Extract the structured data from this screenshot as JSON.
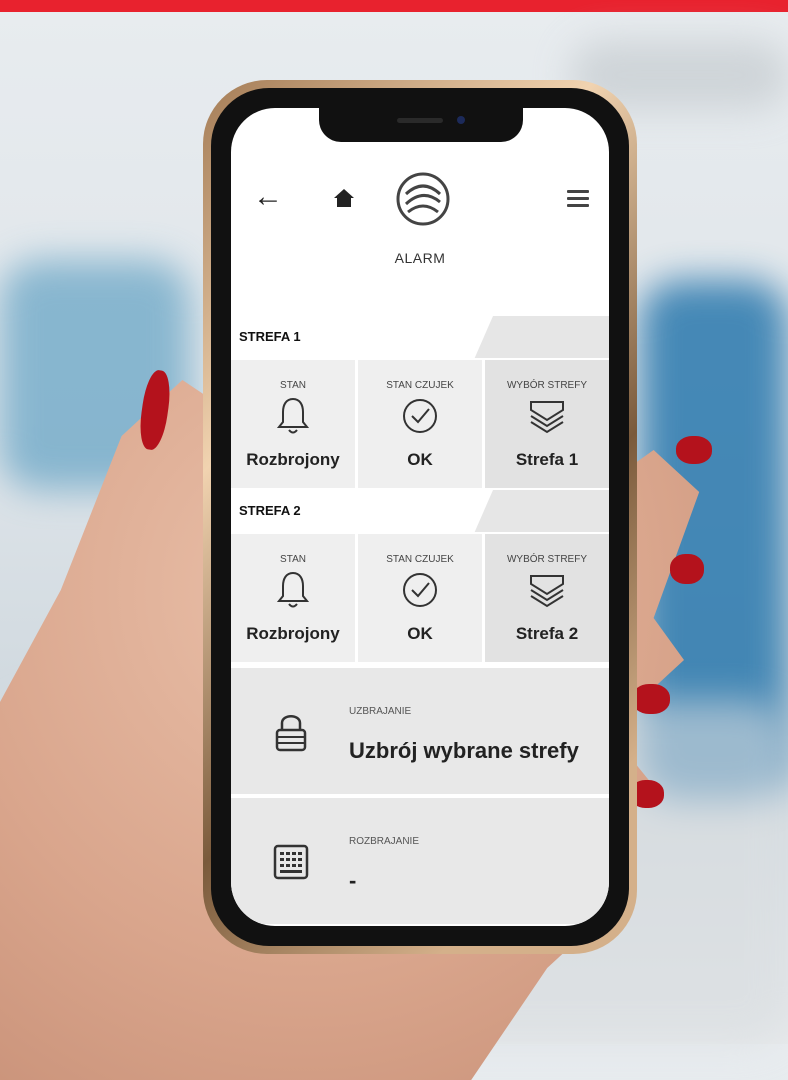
{
  "app": {
    "title": "ALARM"
  },
  "zones": [
    {
      "label": "STREFA 1",
      "tiles": [
        {
          "caption": "STAN",
          "value": "Rozbrojony",
          "icon": "bell-icon"
        },
        {
          "caption": "STAN CZUJEK",
          "value": "OK",
          "icon": "check-circle-icon"
        },
        {
          "caption": "WYBÓR STREFY",
          "value": "Strefa 1",
          "icon": "layers-icon"
        }
      ]
    },
    {
      "label": "STREFA 2",
      "tiles": [
        {
          "caption": "STAN",
          "value": "Rozbrojony",
          "icon": "bell-icon"
        },
        {
          "caption": "STAN CZUJEK",
          "value": "OK",
          "icon": "check-circle-icon"
        },
        {
          "caption": "WYBÓR STREFY",
          "value": "Strefa 2",
          "icon": "layers-icon"
        }
      ]
    }
  ],
  "actions": {
    "arm": {
      "caption": "UZBRAJANIE",
      "value": "Uzbrój wybrane strefy",
      "icon": "padlock-icon"
    },
    "disarm": {
      "caption": "ROZBRAJANIE",
      "value": "-",
      "icon": "keypad-icon"
    }
  },
  "colors": {
    "brand_red": "#e8222e",
    "nail_red": "#b4121c"
  }
}
